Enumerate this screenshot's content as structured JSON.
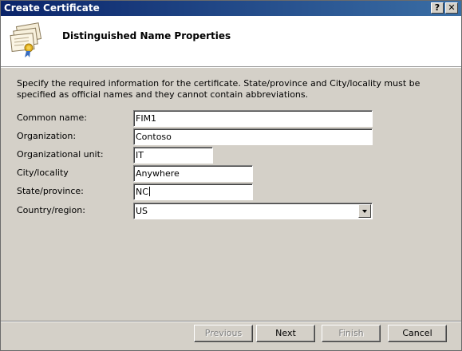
{
  "window": {
    "title": "Create Certificate",
    "help_label": "?",
    "close_label": "✕"
  },
  "header": {
    "title": "Distinguished Name Properties",
    "icon": "certificate-stack-icon"
  },
  "description": "Specify the required information for the certificate. State/province and City/locality must be specified as official names and they cannot contain abbreviations.",
  "form": {
    "common_name": {
      "label": "Common name:",
      "value": "FIM1"
    },
    "organization": {
      "label": "Organization:",
      "value": "Contoso"
    },
    "organizational_unit": {
      "label": "Organizational unit:",
      "value": "IT"
    },
    "city": {
      "label": "City/locality",
      "value": "Anywhere"
    },
    "state": {
      "label": "State/province:",
      "value": "NC"
    },
    "country": {
      "label": "Country/region:",
      "value": "US"
    }
  },
  "buttons": {
    "previous": "Previous",
    "next": "Next",
    "finish": "Finish",
    "cancel": "Cancel"
  },
  "colors": {
    "titlebar_start": "#0a246a",
    "titlebar_end": "#3a6ea5",
    "dialog_face": "#d4d0c8",
    "header_background": "#ffffff"
  }
}
